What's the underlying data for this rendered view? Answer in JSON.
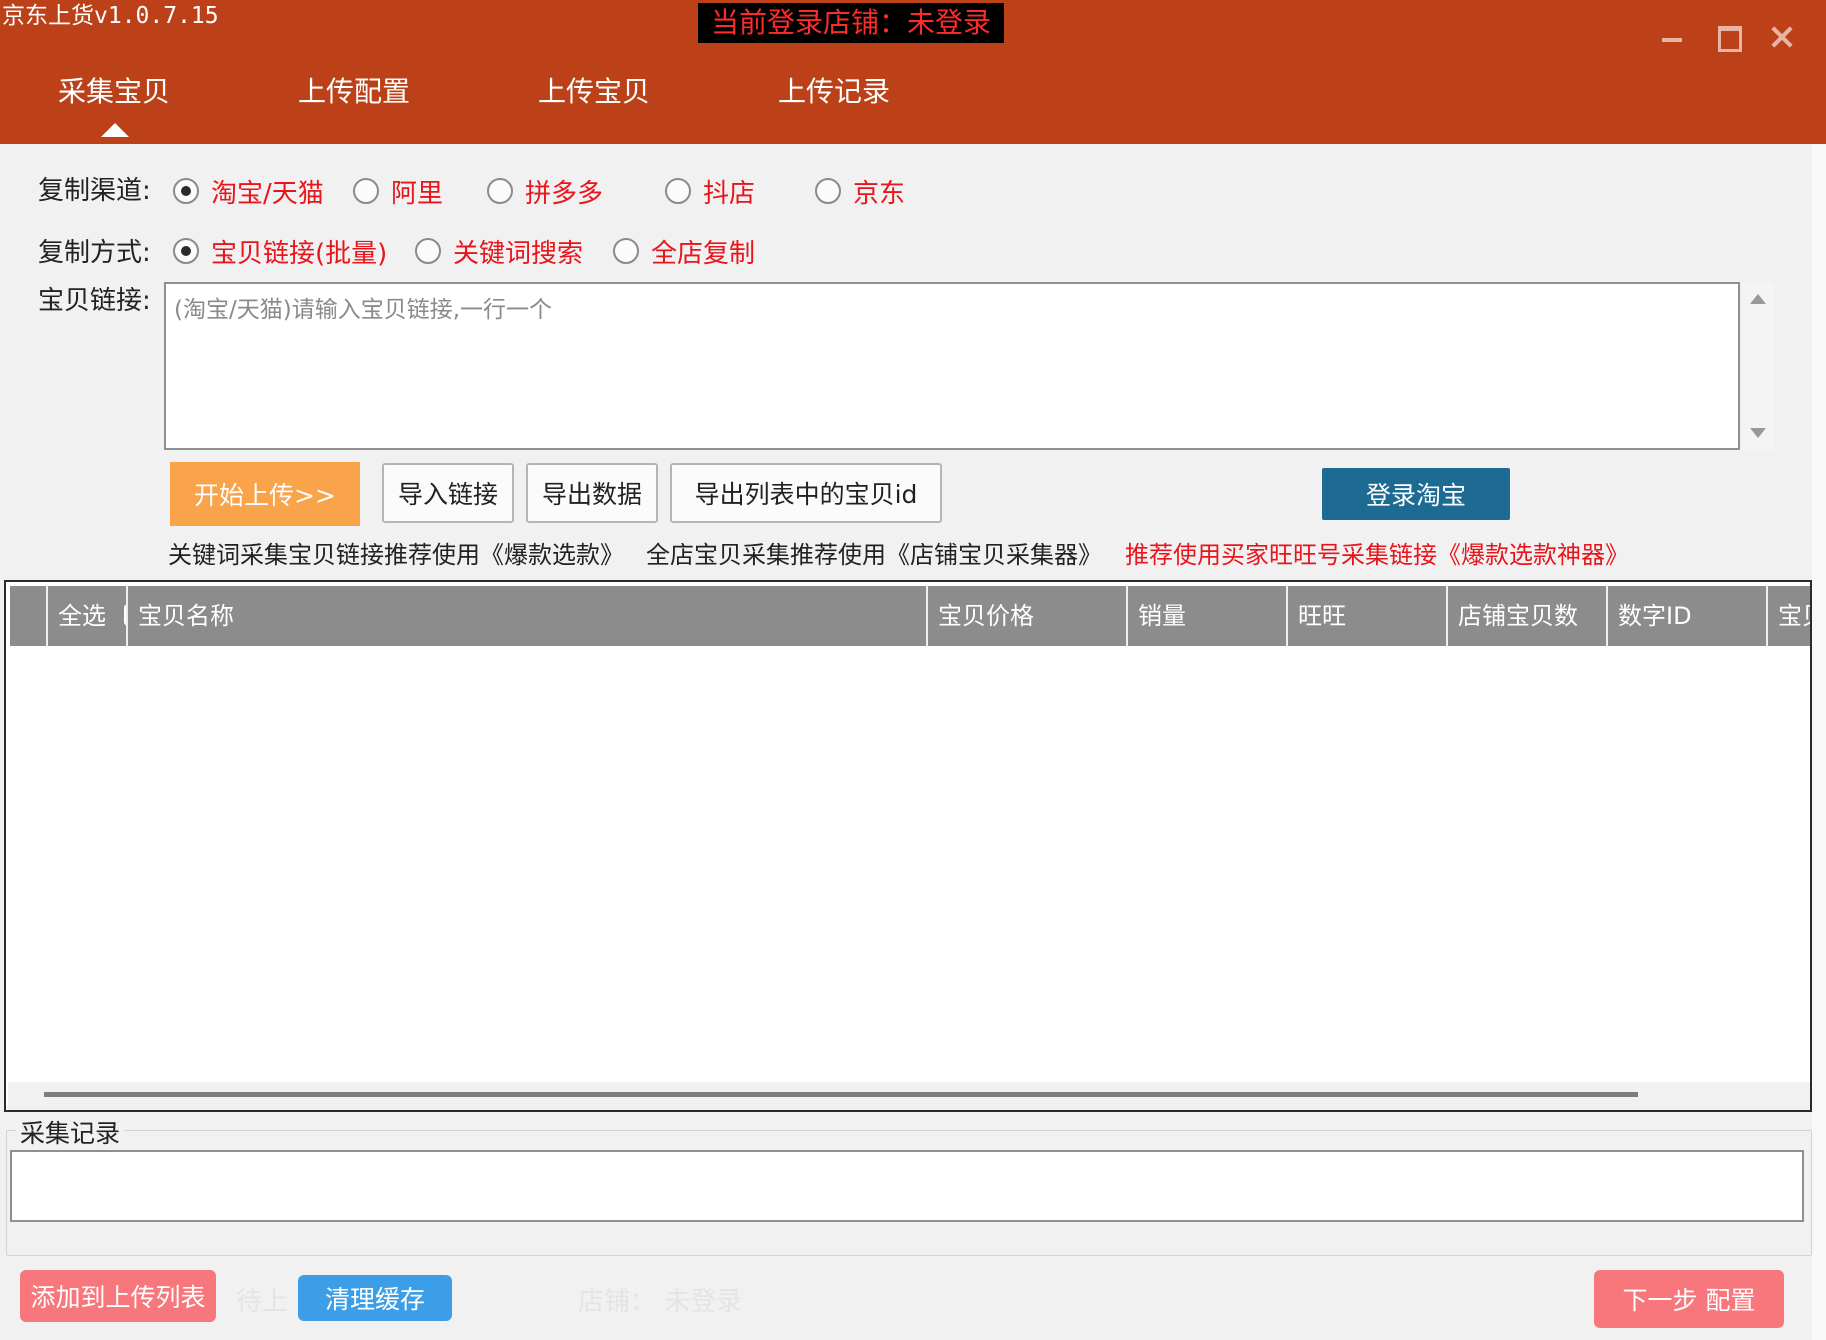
{
  "window": {
    "title": "京东上货v1.0.7.15",
    "login_status": "当前登录店铺：未登录"
  },
  "nav": {
    "tabs": [
      {
        "label": "采集宝贝",
        "active": true
      },
      {
        "label": "上传配置",
        "active": false
      },
      {
        "label": "上传宝贝",
        "active": false
      },
      {
        "label": "上传记录",
        "active": false
      }
    ]
  },
  "form": {
    "channel_label": "复制渠道:",
    "channels": [
      {
        "label": "淘宝/天猫",
        "checked": true
      },
      {
        "label": "阿里",
        "checked": false
      },
      {
        "label": "拼多多",
        "checked": false
      },
      {
        "label": "抖店",
        "checked": false
      },
      {
        "label": "京东",
        "checked": false
      }
    ],
    "mode_label": "复制方式:",
    "modes": [
      {
        "label": "宝贝链接(批量)",
        "checked": true
      },
      {
        "label": "关键词搜索",
        "checked": false
      },
      {
        "label": "全店复制",
        "checked": false
      }
    ],
    "link_label": "宝贝链接:",
    "link_value": "",
    "link_placeholder": "(淘宝/天猫)请输入宝贝链接,一行一个"
  },
  "actions": {
    "start_upload": "开始上传>>",
    "import_links": "导入链接",
    "export_data": "导出数据",
    "export_ids": "导出列表中的宝贝id",
    "login_taobao": "登录淘宝"
  },
  "tips": {
    "keyword": "关键词采集宝贝链接推荐使用《爆款选款》",
    "shop": "全店宝贝采集推荐使用《店铺宝贝采集器》",
    "buyer": "推荐使用买家旺旺号采集链接《爆款选款神器》"
  },
  "grid": {
    "select_all": "全选",
    "columns": [
      "宝贝名称",
      "宝贝价格",
      "销量",
      "旺旺",
      "店铺宝贝数",
      "数字ID",
      "宝贝"
    ],
    "rows": []
  },
  "log": {
    "title": "采集记录",
    "content": ""
  },
  "footer": {
    "add_to_upload": "添加到上传列表",
    "pending_label": "待上",
    "clear_cache": "清理缓存",
    "shop_status": "店铺：  未登录",
    "next_step": "下一步 配置"
  },
  "colors": {
    "header_bg": "#bc4119",
    "accent_red": "#e8151c",
    "start_button": "#f9a34a",
    "login_button": "#1d6a92",
    "pink_button": "#f7777c",
    "blue_button": "#3c9ee6",
    "grid_header": "#8c8c8c"
  }
}
